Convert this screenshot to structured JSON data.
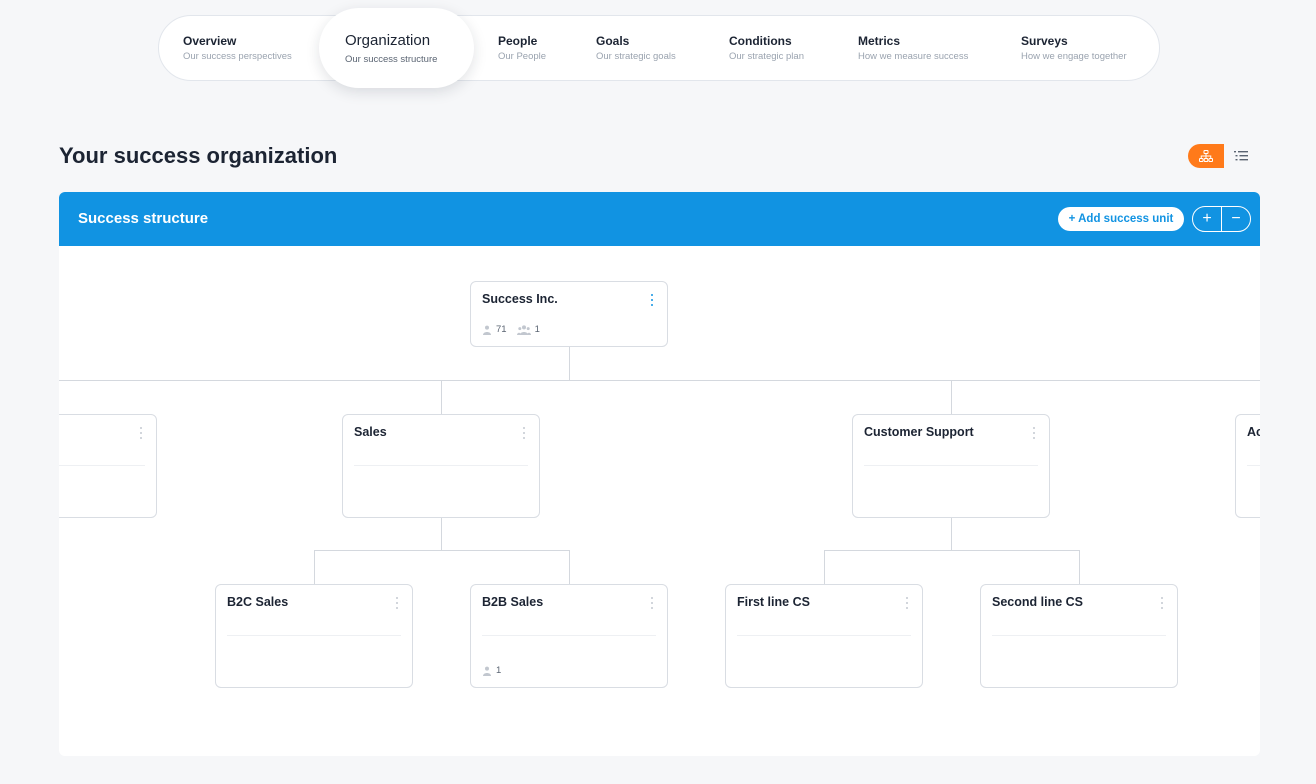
{
  "nav": {
    "items": [
      {
        "title": "Overview",
        "subtitle": "Our success perspectives"
      },
      {
        "title": "Organization",
        "subtitle": "Our success structure"
      },
      {
        "title": "People",
        "subtitle": "Our People"
      },
      {
        "title": "Goals",
        "subtitle": "Our strategic goals"
      },
      {
        "title": "Conditions",
        "subtitle": "Our strategic plan"
      },
      {
        "title": "Metrics",
        "subtitle": "How we measure success"
      },
      {
        "title": "Surveys",
        "subtitle": "How we engage together"
      }
    ],
    "active_index": 1
  },
  "page_title": "Your success organization",
  "view_toggle": {
    "active": "org-chart",
    "accent_color": "#ff7a1a"
  },
  "panel": {
    "title": "Success structure",
    "add_label": "+ Add success unit",
    "zoom_in": "+",
    "zoom_out": "−",
    "header_color": "#1193e2"
  },
  "tree": {
    "root": {
      "name": "Success Inc.",
      "people": "71",
      "teams": "1"
    },
    "level1": [
      {
        "name": ""
      },
      {
        "name": "Sales"
      },
      {
        "name": "Customer Support"
      },
      {
        "name": "Ac"
      }
    ],
    "level2": [
      {
        "name": "B2C Sales"
      },
      {
        "name": "B2B Sales",
        "people": "1"
      },
      {
        "name": "First line CS"
      },
      {
        "name": "Second line CS"
      }
    ]
  }
}
